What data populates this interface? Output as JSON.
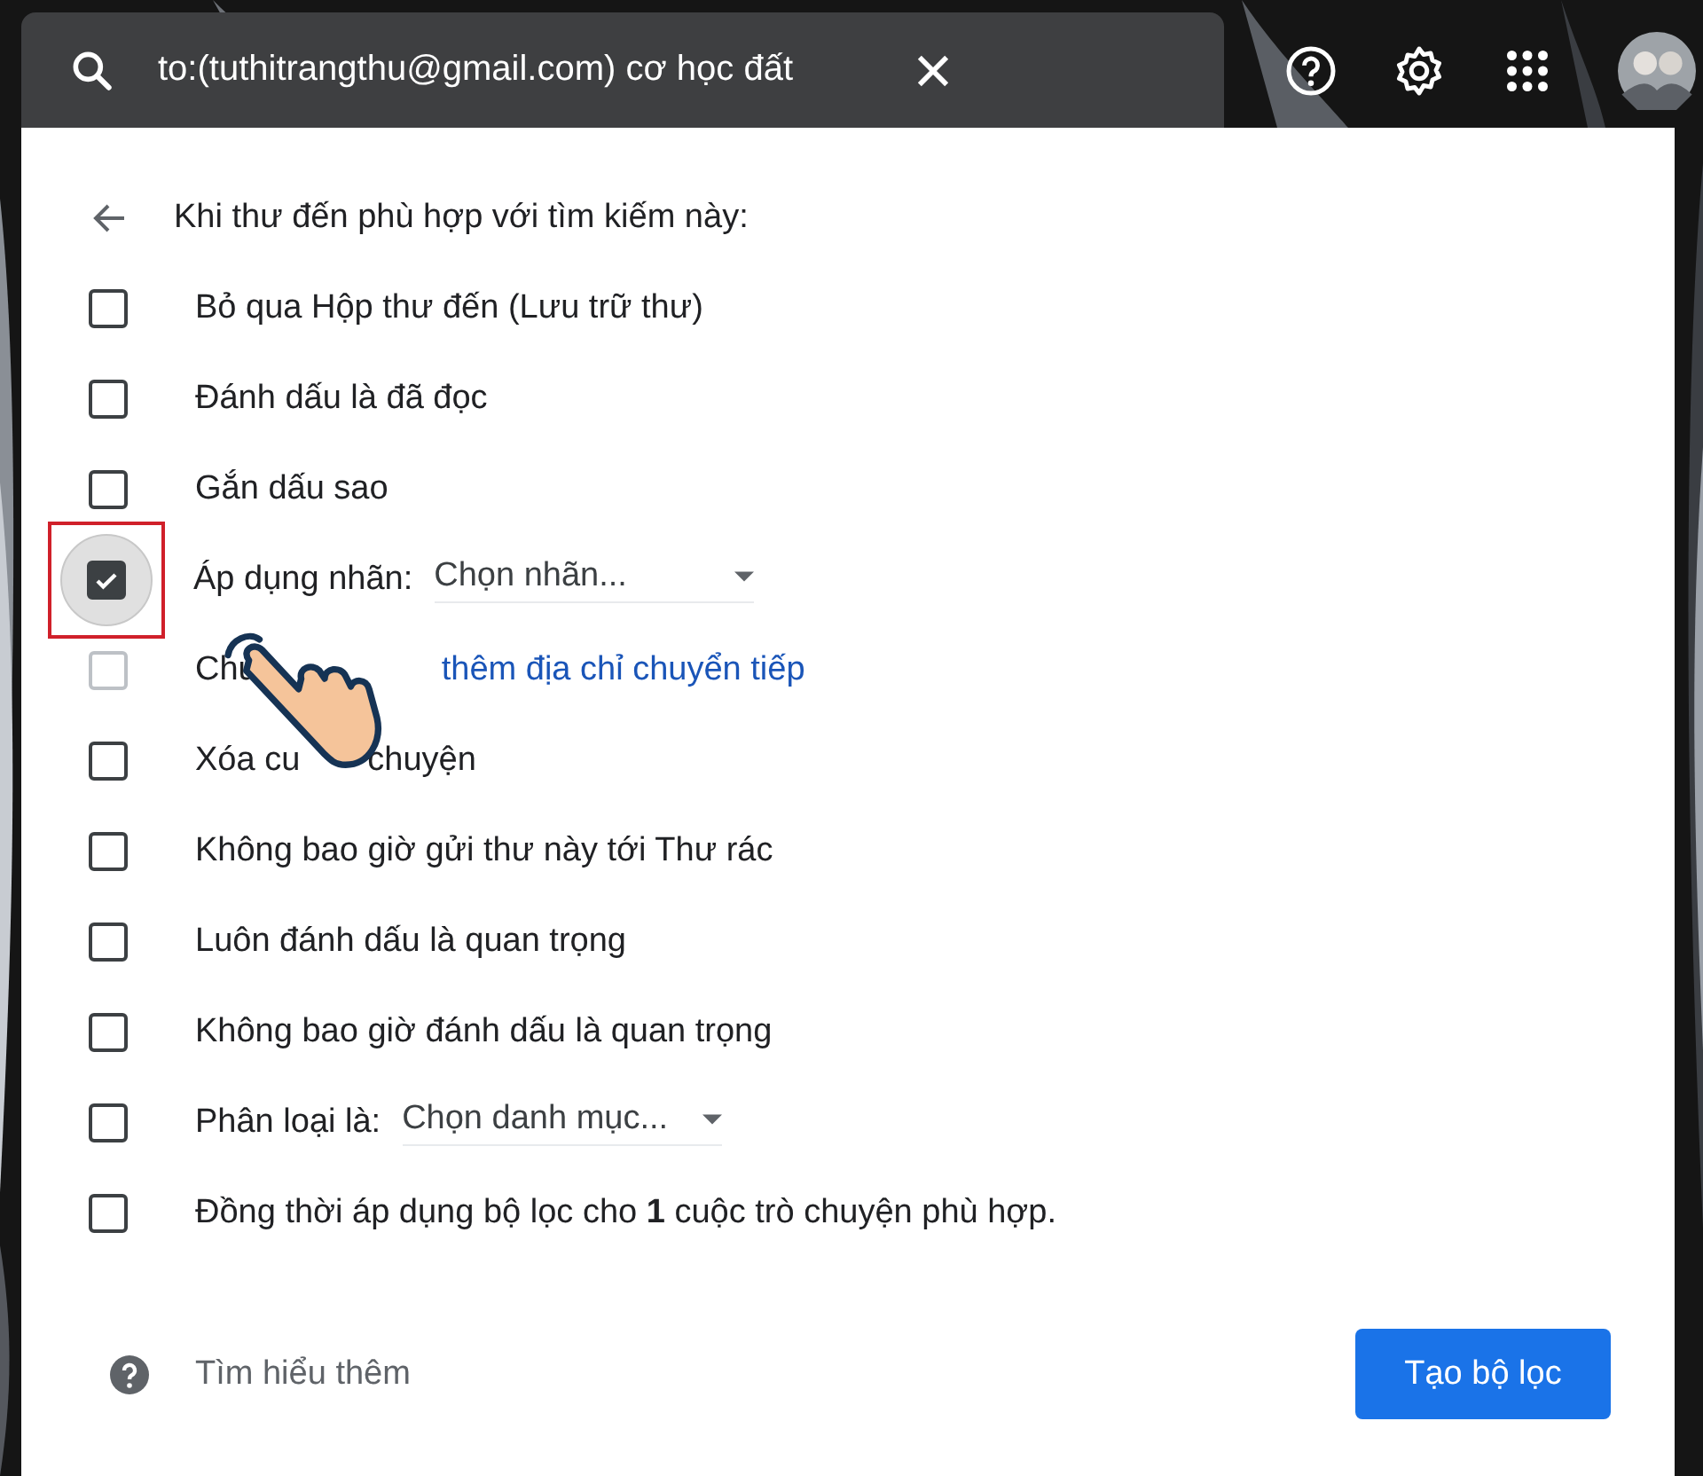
{
  "search": {
    "value": "to:(tuthitrangthu@gmail.com) cơ học đất"
  },
  "heading": "Khi thư đến phù hợp với tìm kiếm này:",
  "rows": [
    {
      "kind": "plain",
      "label": "Bỏ qua Hộp thư đến (Lưu trữ thư)",
      "checked": false,
      "disabled": false,
      "highlighted": false
    },
    {
      "kind": "plain",
      "label": "Đánh dấu là đã đọc",
      "checked": false,
      "disabled": false,
      "highlighted": false
    },
    {
      "kind": "plain",
      "label": "Gắn dấu sao",
      "checked": false,
      "disabled": false,
      "highlighted": false
    },
    {
      "kind": "select",
      "label": "Áp dụng nhãn:",
      "select": "Chọn nhãn...",
      "checked": true,
      "disabled": false,
      "highlighted": true
    },
    {
      "kind": "link",
      "label": "Chu",
      "link": "thêm địa chỉ chuyển tiếp",
      "checked": false,
      "disabled": true,
      "highlighted": false
    },
    {
      "kind": "covered",
      "label": "Xóa cu",
      "tail": "chuyện",
      "checked": false,
      "disabled": false,
      "highlighted": false
    },
    {
      "kind": "plain",
      "label": "Không bao giờ gửi thư này tới Thư rác",
      "checked": false,
      "disabled": false,
      "highlighted": false
    },
    {
      "kind": "plain",
      "label": "Luôn đánh dấu là quan trọng",
      "checked": false,
      "disabled": false,
      "highlighted": false
    },
    {
      "kind": "plain",
      "label": "Không bao giờ đánh dấu là quan trọng",
      "checked": false,
      "disabled": false,
      "highlighted": false
    },
    {
      "kind": "select",
      "label": "Phân loại là:",
      "select": "Chọn danh mục...",
      "checked": false,
      "disabled": false,
      "highlighted": false
    },
    {
      "kind": "plain",
      "label": "Đồng thời áp dụng bộ lọc cho **1** cuộc trò chuyện phù hợp.",
      "checked": false,
      "disabled": false,
      "highlighted": false
    }
  ],
  "footer": {
    "learn_more": "Tìm hiểu thêm",
    "create_button": "Tạo bộ lọc"
  }
}
